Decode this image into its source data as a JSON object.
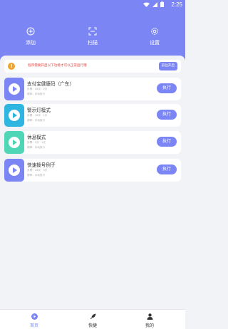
{
  "status_bar": {
    "time": "2:25"
  },
  "header": {
    "actions": [
      {
        "label": "添加",
        "icon": "plus-circle-icon"
      },
      {
        "label": "扫描",
        "icon": "scan-icon"
      },
      {
        "label": "设置",
        "icon": "gear-icon"
      }
    ]
  },
  "notice": {
    "text": "程序需要开启以下功能才可以正常运行哦",
    "button": "前往开启"
  },
  "cards": [
    {
      "title": "支付宝健康码（广东）",
      "meta1": "步骤：18次 · 2天",
      "meta2": "频率：手动执行",
      "button": "执行",
      "color": "#7b86f4"
    },
    {
      "title": "警示灯模式",
      "meta1": "步骤：18次 · 1天",
      "meta2": "频率：手动执行",
      "button": "执行",
      "color": "#2fb6e0"
    },
    {
      "title": "休息模式",
      "meta1": "步骤：5次 · 1天",
      "meta2": "频率：手动执行",
      "button": "执行",
      "color": "#4fd6b6"
    },
    {
      "title": "快速拨号例子",
      "meta1": "步骤：18次 · 3天",
      "meta2": "频率：手动执行",
      "button": "执行",
      "color": "#7b86f4"
    }
  ],
  "tabbar": {
    "tabs": [
      {
        "label": "首页",
        "icon": "play-circle-icon",
        "active": true
      },
      {
        "label": "快捷",
        "icon": "rocket-icon",
        "active": false
      },
      {
        "label": "我的",
        "icon": "person-icon",
        "active": false
      }
    ]
  },
  "colors": {
    "accent": "#7b86f4",
    "warning": "#f2a32a",
    "alert_text": "#e2463f"
  }
}
